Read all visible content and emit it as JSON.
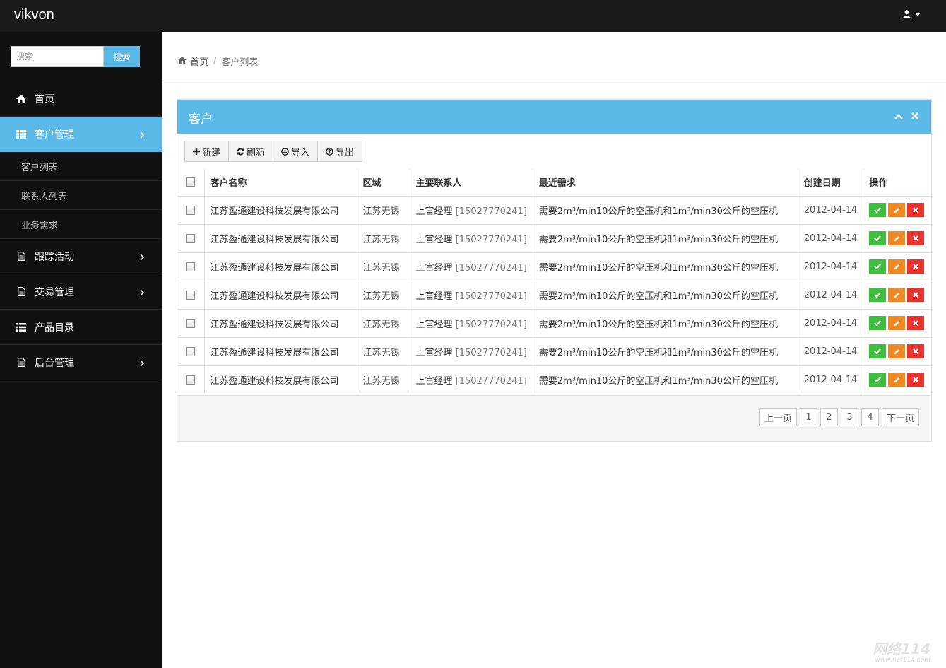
{
  "brand": "vikvon",
  "user_icon": "user-icon",
  "colors": {
    "topbar": "#1a1a1a",
    "sidebar": "#111111",
    "accent": "#5bb9e8",
    "ok": "#3fbf3f",
    "edit": "#f08a24",
    "delete": "#e8322c"
  },
  "sidebar": {
    "search": {
      "placeholder": "搜索",
      "button": "搜索"
    },
    "items": [
      {
        "label": "首页",
        "icon": "home-icon"
      },
      {
        "label": "客户管理",
        "icon": "grid-icon",
        "active": true,
        "children": [
          "客户列表",
          "联系人列表",
          "业务需求"
        ]
      },
      {
        "label": "跟踪活动",
        "icon": "file-icon"
      },
      {
        "label": "交易管理",
        "icon": "file-icon"
      },
      {
        "label": "产品目录",
        "icon": "list-icon"
      },
      {
        "label": "后台管理",
        "icon": "file-icon"
      }
    ]
  },
  "breadcrumb": {
    "home": "首页",
    "current": "客户列表"
  },
  "panel": {
    "title": "客户",
    "toolbar": {
      "new": "新建",
      "refresh": "刷新",
      "import": "导入",
      "export": "导出"
    },
    "columns": [
      "客户名称",
      "区域",
      "主要联系人",
      "最近需求",
      "创建日期",
      "操作"
    ],
    "rows": [
      {
        "name": "江苏盈通建设科技发展有限公司",
        "region": "江苏无锡",
        "contact": "上官经理",
        "phone": "[15027770241]",
        "need": "需要2m³/min10公斤的空压机和1m³/min30公斤的空压机",
        "date": "2012-04-14"
      },
      {
        "name": "江苏盈通建设科技发展有限公司",
        "region": "江苏无锡",
        "contact": "上官经理",
        "phone": "[15027770241]",
        "need": "需要2m³/min10公斤的空压机和1m³/min30公斤的空压机",
        "date": "2012-04-14"
      },
      {
        "name": "江苏盈通建设科技发展有限公司",
        "region": "江苏无锡",
        "contact": "上官经理",
        "phone": "[15027770241]",
        "need": "需要2m³/min10公斤的空压机和1m³/min30公斤的空压机",
        "date": "2012-04-14"
      },
      {
        "name": "江苏盈通建设科技发展有限公司",
        "region": "江苏无锡",
        "contact": "上官经理",
        "phone": "[15027770241]",
        "need": "需要2m³/min10公斤的空压机和1m³/min30公斤的空压机",
        "date": "2012-04-14"
      },
      {
        "name": "江苏盈通建设科技发展有限公司",
        "region": "江苏无锡",
        "contact": "上官经理",
        "phone": "[15027770241]",
        "need": "需要2m³/min10公斤的空压机和1m³/min30公斤的空压机",
        "date": "2012-04-14"
      },
      {
        "name": "江苏盈通建设科技发展有限公司",
        "region": "江苏无锡",
        "contact": "上官经理",
        "phone": "[15027770241]",
        "need": "需要2m³/min10公斤的空压机和1m³/min30公斤的空压机",
        "date": "2012-04-14"
      },
      {
        "name": "江苏盈通建设科技发展有限公司",
        "region": "江苏无锡",
        "contact": "上官经理",
        "phone": "[15027770241]",
        "need": "需要2m³/min10公斤的空压机和1m³/min30公斤的空压机",
        "date": "2012-04-14"
      }
    ],
    "pagination": {
      "prev": "上一页",
      "pages": [
        "1",
        "2",
        "3",
        "4"
      ],
      "next": "下一页"
    }
  },
  "watermark": {
    "title": "网络114",
    "url": "www.net114.com"
  }
}
